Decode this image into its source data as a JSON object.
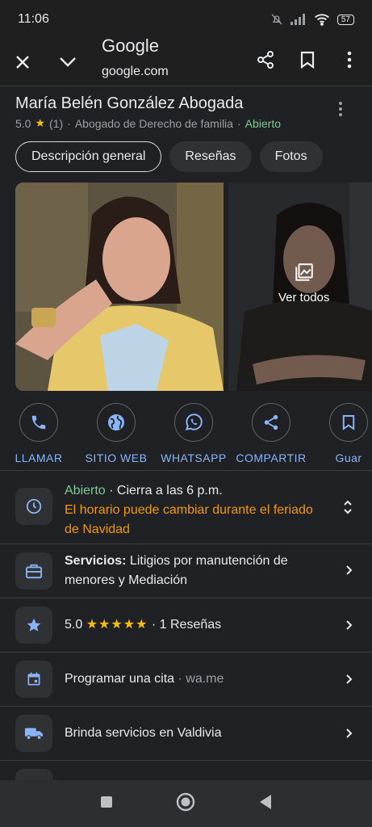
{
  "status_bar": {
    "time": "11:06",
    "battery": "57"
  },
  "browser": {
    "title": "Google",
    "url": "google.com"
  },
  "place": {
    "name": "María Belén González Abogada",
    "rating": "5.0",
    "review_count": "(1)",
    "category": "Abogado de Derecho de familia",
    "open_status": "Abierto"
  },
  "tabs": [
    "Descripción general",
    "Reseñas",
    "Fotos"
  ],
  "photos": {
    "see_all": "Ver todos"
  },
  "actions": [
    {
      "label": "LLAMAR",
      "icon": "phone-icon"
    },
    {
      "label": "SITIO WEB",
      "icon": "globe-icon"
    },
    {
      "label": "WHATSAPP",
      "icon": "whatsapp-icon"
    },
    {
      "label": "COMPARTIR",
      "icon": "share-icon"
    },
    {
      "label": "Guar",
      "icon": "bookmark-icon"
    }
  ],
  "hours": {
    "status": "Abierto",
    "closes": " · Cierra a las 6 p.m.",
    "warning": "El horario puede cambiar durante el feriado de Navidad"
  },
  "services": {
    "label": "Servicios:",
    "text": " Litigios por manutención de menores y Mediación"
  },
  "reviews": {
    "rating": "5.0",
    "stars": "★★★★★",
    "count": " · 1 Reseñas"
  },
  "appointment": {
    "label": "Programar una cita",
    "source": " · wa.me"
  },
  "service_area": {
    "label": "Brinda servicios en Valdivia"
  },
  "colors": {
    "accent": "#8ab4f8",
    "open": "#81c995",
    "warning": "#f29900",
    "star": "#fbbc04"
  }
}
